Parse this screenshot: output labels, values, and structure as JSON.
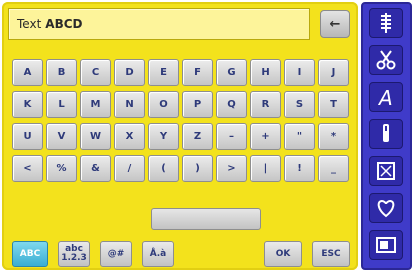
{
  "text_field": {
    "label": "Text",
    "value": "ABCD"
  },
  "backspace_label": "←",
  "keys": [
    "A",
    "B",
    "C",
    "D",
    "E",
    "F",
    "G",
    "H",
    "I",
    "J",
    "K",
    "L",
    "M",
    "N",
    "O",
    "P",
    "Q",
    "R",
    "S",
    "T",
    "U",
    "V",
    "W",
    "X",
    "Y",
    "Z",
    "–",
    "+",
    "\"",
    "*",
    "<",
    "%",
    "&",
    "/",
    "(",
    ")",
    ">",
    "|",
    "!",
    "_"
  ],
  "mode_buttons": {
    "abc": "ABC",
    "abc_lower_top": "abc",
    "abc_lower_bottom": "1.2.3",
    "special": "@#",
    "accented": "Å.à"
  },
  "ok_label": "OK",
  "esc_label": "ESC",
  "sidebar_icons": [
    "stitch-icon",
    "scissors-icon",
    "font-a-icon",
    "needle-icon",
    "frame-icon",
    "heart-icon",
    "info-icon"
  ],
  "colors": {
    "main": "#f3e21c",
    "sidebar": "#3f3bc9",
    "active": "#3aaed2"
  }
}
